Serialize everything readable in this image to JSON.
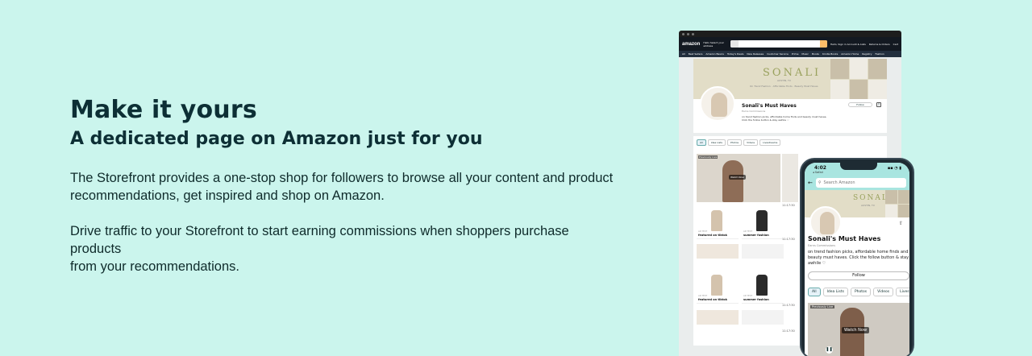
{
  "hero": {
    "title": "Make it yours",
    "subtitle": "A dedicated page on Amazon just for you",
    "paragraph_1_line_1": "The Storefront provides a one-stop shop for followers to browse all your content and product",
    "paragraph_1_line_2": "recommendations, get inspired and shop on Amazon.",
    "paragraph_2_line_1": "Drive traffic to your Storefront to start earning commissions when shoppers purchase products",
    "paragraph_2_line_2": "from your recommendations."
  },
  "desktop": {
    "logo": "amazon",
    "deliver_to": "Hello\nSelect your address",
    "account": "Hello, Sign in\nAccount & Lists",
    "returns": "Returns\n& Orders",
    "cart": "Cart",
    "nav": [
      "All",
      "Best Sellers",
      "Amazon Basics",
      "Today's Deals",
      "New Releases",
      "Customer Service",
      "Prime",
      "Music",
      "Books",
      "Kindle Books",
      "Amazon Home",
      "Registry",
      "Fashion"
    ],
    "brand": "SONALI",
    "brand_location": "AUSTIN, TX",
    "brand_tagline": "On Trend Fashion · Affordable Finds · Beauty Must Haves",
    "store_name": "Sonali's Must Haves",
    "earns": "Earns Commissions",
    "bio_line_1": "on trend fashion picks, affordable home finds and beauty must haves.",
    "bio_line_2": "Click the follow button & stay awhile ♡",
    "follow": "Follow",
    "tabs": [
      "All",
      "Idea Lists",
      "Photos",
      "Videos",
      "Livestreams"
    ],
    "video_label": "Previously Live",
    "watch_now": "Watch Now",
    "time_1": "11:17:30",
    "time_2": "11:17:30",
    "time_3": "11:17:30",
    "time_4": "11:17:30",
    "items": [
      {
        "pre": "AD TEXT",
        "caption": "featured on tiktok"
      },
      {
        "pre": "AD TEXT",
        "caption": "summer fashion"
      },
      {
        "pre": "AD TEXT",
        "caption": "featured on tiktok"
      },
      {
        "pre": "AD TEXT",
        "caption": "summer fashion"
      }
    ]
  },
  "phone": {
    "time": "4:02",
    "carrier": "◂ Safari",
    "signal": "▪▪ ◔ ▮",
    "search_placeholder": "Search Amazon",
    "brand": "SONALI",
    "brand_location": "AUSTIN, TX",
    "store_name": "Sonali's Must Haves",
    "earns": "Earns Commissions",
    "bio": "on trend fashion picks, affordable home finds and beauty must haves. Click the follow button & stay awhile ♡",
    "follow": "Follow",
    "tabs": [
      "All",
      "Idea Lists",
      "Photos",
      "Videos",
      "Livestream"
    ],
    "video_label": "Previously Live",
    "watch_now": "Watch Now"
  }
}
